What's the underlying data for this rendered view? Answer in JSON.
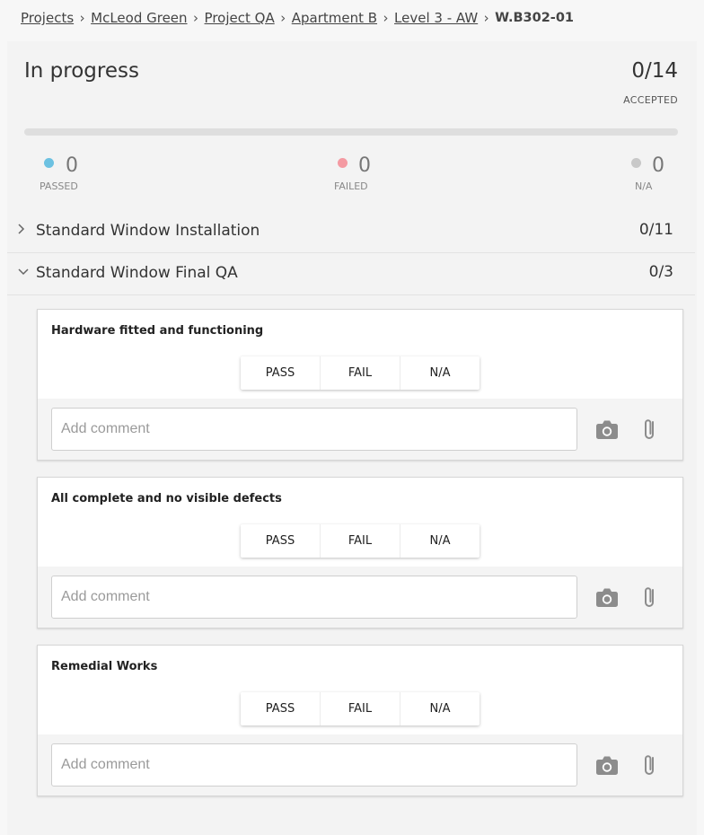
{
  "breadcrumb": {
    "items": [
      "Projects",
      "McLeod Green",
      "Project QA",
      "Apartment B",
      "Level 3 - AW"
    ],
    "current": "W.B302-01"
  },
  "summary": {
    "status": "In progress",
    "progress_count": "0/14",
    "accepted_label": "ACCEPTED",
    "progress_fraction": 0
  },
  "stats": [
    {
      "value": "0",
      "label": "PASSED",
      "color": "#6cc1e1"
    },
    {
      "value": "0",
      "label": "FAILED",
      "color": "#f49aa2"
    },
    {
      "value": "0",
      "label": "N/A",
      "color": "#c8c8c8"
    }
  ],
  "sections": [
    {
      "title": "Standard Window Installation",
      "count": "0/11",
      "expanded": false
    },
    {
      "title": "Standard Window Final QA",
      "count": "0/3",
      "expanded": true
    }
  ],
  "choice_labels": {
    "pass": "PASS",
    "fail": "FAIL",
    "na": "N/A"
  },
  "comment_placeholder": "Add comment",
  "icons": {
    "camera": "camera-icon",
    "attach": "paperclip-icon",
    "collapsed": "chevron-right-icon",
    "expanded": "chevron-down-icon"
  },
  "items": [
    {
      "title": "Hardware fitted and functioning"
    },
    {
      "title": "All complete and no visible defects"
    },
    {
      "title": "Remedial Works"
    }
  ]
}
